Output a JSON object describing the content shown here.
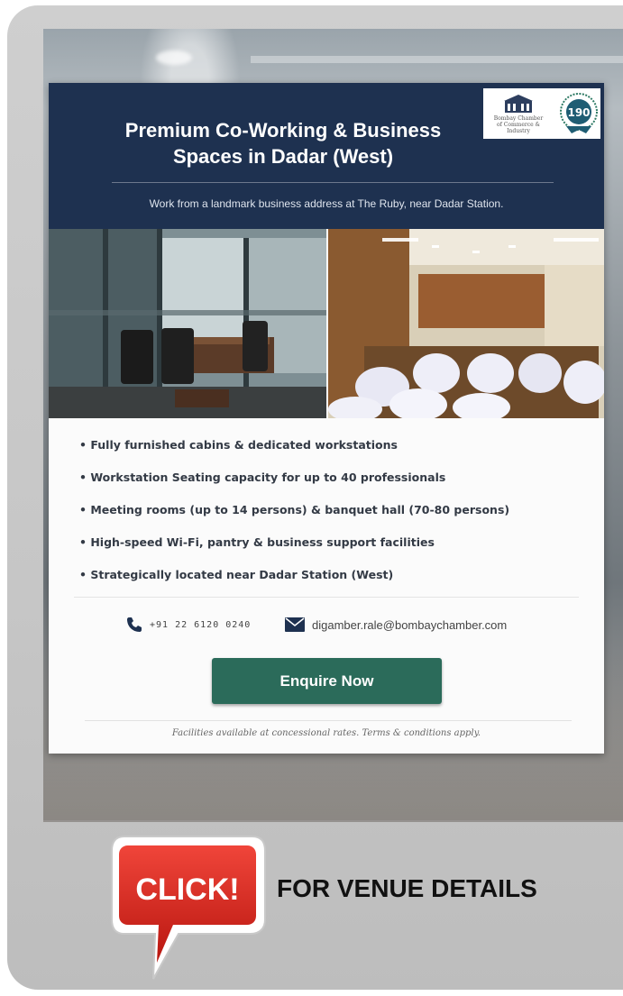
{
  "flyer": {
    "title_line1": "Premium Co-Working & Business",
    "title_line2": "Spaces in Dadar (West)",
    "subtitle": "Work from a landmark business address at The Ruby, near Dadar Station.",
    "logo": {
      "org_line1": "Bombay Chamber",
      "org_line2": "of Commerce & Industry",
      "seal_number": "190"
    },
    "features": [
      "• Fully furnished cabins & dedicated workstations",
      "• Workstation Seating capacity for up to 40 professionals",
      "• Meeting rooms (up to 14 persons) & banquet hall (70-80 persons)",
      "• High-speed Wi-Fi, pantry & business support facilities",
      "• Strategically located near Dadar Station (West)"
    ],
    "phone": "+91 22 6120 0240",
    "email": "digamber.rale@bombaychamber.com",
    "cta_label": "Enquire Now",
    "footnote": "Facilities available at concessional rates. Terms & conditions apply."
  },
  "click_badge": {
    "text": "CLICK!"
  },
  "venue_link": {
    "label": "FOR VENUE DETAILS"
  },
  "colors": {
    "navy": "#1e3150",
    "cta_green": "#2b6b5a",
    "badge_red": "#d8261d"
  },
  "icons": [
    "phone-icon",
    "mail-icon",
    "building-logo-icon",
    "seal-icon",
    "click-speech-bubble-icon"
  ]
}
